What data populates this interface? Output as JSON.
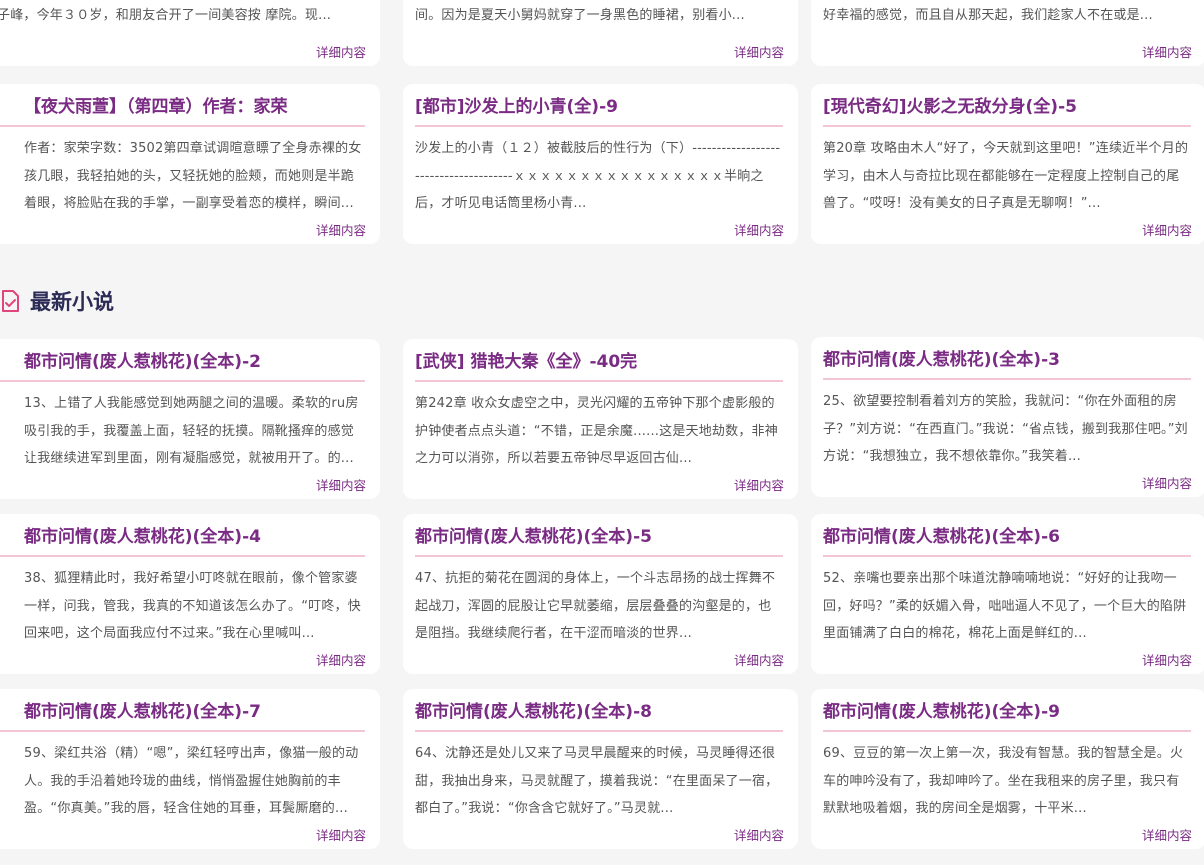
{
  "section": {
    "title": "最新小说",
    "icon": "document-check-icon",
    "accent": "#e0457b"
  },
  "top_cards": [
    {
      "title": "",
      "desc": "子峰，今年３０岁，和朋友合开了一间美容按 摩院。现...",
      "more": "详细内容"
    },
    {
      "title": "",
      "desc": "间。因为是夏天小舅妈就穿了一身黑色的睡裙，别看小...",
      "more": "详细内容"
    },
    {
      "title": "",
      "desc": "好幸福的感觉，而且自从那天起，我们趁家人不在或是...",
      "more": "详细内容"
    }
  ],
  "cards_row1": [
    {
      "title": "【夜犬雨萱】（第四章）作者：家荣",
      "desc": "作者：家荣字数：3502第四章试调暄意瞟了全身赤裸的女孩几眼，我轻拍她的头，又轻抚她的脸颊，而她则是半跪着眼，将脸贴在我的手掌，一副享受着恋的模样，瞬间...",
      "more": "详细内容"
    },
    {
      "title": "[都市]沙发上的小青(全)-9",
      "desc": "沙发上的小青（１２）被截肢后的性行为（下）--------------------------------------ｘｘｘｘｘｘｘｘｘｘｘｘｘｘｘｘ半晌之后，才听见电话筒里杨小青...",
      "more": "详细内容"
    },
    {
      "title": "[現代奇幻]火影之无敌分身(全)-5",
      "desc": "第20章 攻略由木人“好了，今天就到这里吧！”连续近半个月的学习，由木人与奇拉比现在都能够在一定程度上控制自己的尾兽了。“哎呀！没有美女的日子真是无聊啊！”...",
      "more": "详细内容"
    }
  ],
  "cards_row2": [
    {
      "title": "都市问情(废人惹桃花)(全本)-2",
      "desc": "13、上错了人我能感觉到她两腿之间的温暖。柔软的ru房吸引我的手，我覆盖上面，轻轻的抚摸。隔靴搔痒的感觉让我继续进军到里面，刚有凝脂感觉，就被用开了。的...",
      "more": "详细内容"
    },
    {
      "title": "[武侠] 猎艳大秦《全》-40完",
      "desc": "第242章 收众女虚空之中，灵光闪耀的五帝钟下那个虚影般的护钟使者点点头道：“不错，正是余魔......这是天地劫数，非神之力可以消弥，所以若要五帝钟尽早返回古仙...",
      "more": "详细内容"
    },
    {
      "title": "都市问情(废人惹桃花)(全本)-3",
      "desc": "25、欲望要控制看着刘方的笑脸，我就问：“你在外面租的房子？”刘方说：“在西直门。”我说：“省点钱，搬到我那住吧。”刘方说：“我想独立，我不想依靠你。”我笑着...",
      "more": "详细内容"
    }
  ],
  "cards_row3": [
    {
      "title": "都市问情(废人惹桃花)(全本)-4",
      "desc": "38、狐狸精此时，我好希望小叮咚就在眼前，像个管家婆一样，问我，管我，我真的不知道该怎么办了。“叮咚，快回来吧，这个局面我应付不过来。”我在心里喊叫...",
      "more": "详细内容"
    },
    {
      "title": "都市问情(废人惹桃花)(全本)-5",
      "desc": "47、抗拒的菊花在圆润的身体上，一个斗志昂扬的战士挥舞不起战刀，浑圆的屁股让它早就萎缩，层层叠叠的沟壑是的，也是阻挡。我继续爬行者，在干涩而暗淡的世界...",
      "more": "详细内容"
    },
    {
      "title": "都市问情(废人惹桃花)(全本)-6",
      "desc": "52、亲嘴也要亲出那个味道沈静喃喃地说：“好好的让我吻一回，好吗？”柔的妖媚入骨，咄咄逼人不见了，一个巨大的陷阱里面铺满了白白的棉花，棉花上面是鲜红的...",
      "more": "详细内容"
    }
  ],
  "cards_row4": [
    {
      "title": "都市问情(废人惹桃花)(全本)-7",
      "desc": "59、梁红共浴（精）“嗯”，梁红轻哼出声，像猫一般的动人。我的手沿着她玲珑的曲线，悄悄盈握住她胸前的丰盈。“你真美。”我的唇，轻含住她的耳垂，耳鬓厮磨的...",
      "more": "详细内容"
    },
    {
      "title": "都市问情(废人惹桃花)(全本)-8",
      "desc": "64、沈静还是处儿又来了马灵早晨醒来的时候，马灵睡得还很甜，我抽出身来，马灵就醒了，摸着我说：“在里面呆了一宿，都白了。”我说：“你含含它就好了。”马灵就...",
      "more": "详细内容"
    },
    {
      "title": "都市问情(废人惹桃花)(全本)-9",
      "desc": "69、豆豆的第一次上第一次，我没有智慧。我的智慧全是。火车的呻吟没有了，我却呻吟了。坐在我租来的房子里，我只有默默地吸着烟，我的房间全是烟雾，十平米...",
      "more": "详细内容"
    }
  ]
}
